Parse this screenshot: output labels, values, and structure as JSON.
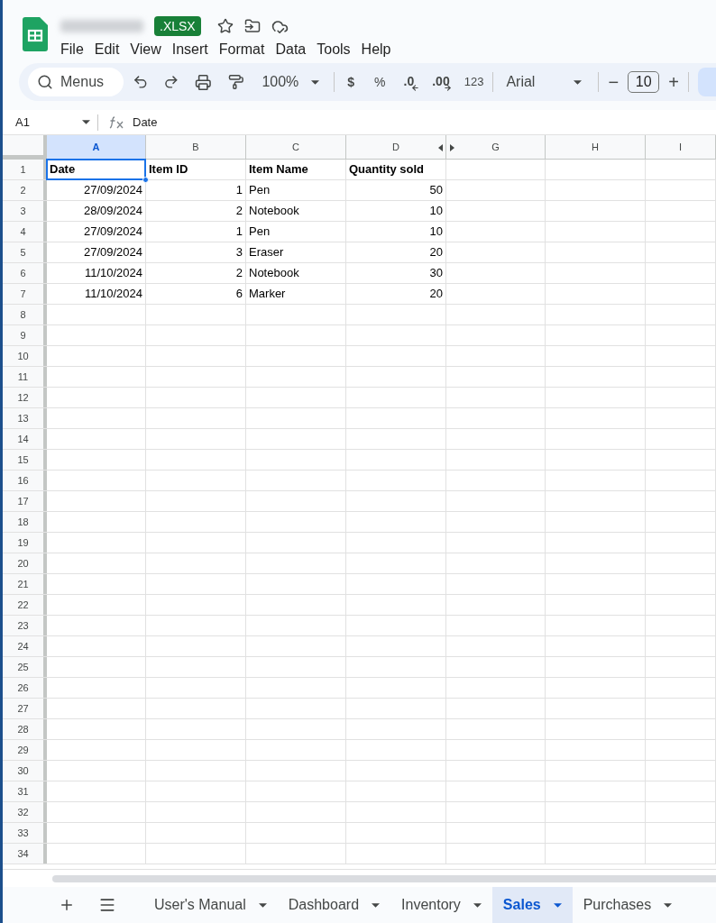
{
  "header": {
    "badge": ".XLSX",
    "menu": [
      "File",
      "Edit",
      "View",
      "Insert",
      "Format",
      "Data",
      "Tools",
      "Help"
    ]
  },
  "toolbar": {
    "search_label": "Menus",
    "zoom": "100%",
    "currency": "$",
    "percent": "%",
    "decrease_decimal": ".0",
    "increase_decimal": ".00",
    "number_format": "123",
    "font": "Arial",
    "font_minus": "−",
    "font_size": "10",
    "font_plus": "+"
  },
  "formula_bar": {
    "name_box": "A1",
    "formula": "Date"
  },
  "grid": {
    "columns": [
      {
        "label": "A",
        "selected": true
      },
      {
        "label": "B",
        "selected": false
      },
      {
        "label": "C",
        "selected": false
      },
      {
        "label": "D",
        "selected": false
      },
      {
        "label": "G",
        "selected": false
      },
      {
        "label": "H",
        "selected": false
      },
      {
        "label": "I",
        "selected": false
      }
    ],
    "row_numbers": [
      "1",
      "2",
      "3",
      "4",
      "5",
      "6",
      "7",
      "8",
      "9",
      "10",
      "11",
      "12",
      "13",
      "14",
      "15",
      "16",
      "17",
      "18",
      "19",
      "20",
      "21",
      "22",
      "23",
      "24",
      "25",
      "26",
      "27",
      "28",
      "29",
      "30",
      "31",
      "32",
      "33",
      "34"
    ],
    "header_row": [
      {
        "text": "Date",
        "selected": true
      },
      {
        "text": "Item ID",
        "selected": false
      },
      {
        "text": "Item Name",
        "selected": false
      },
      {
        "text": "Quantity sold",
        "selected": false
      }
    ],
    "rows": [
      {
        "date": "27/09/2024",
        "item_id": "1",
        "item_name": "Pen",
        "quantity": "50"
      },
      {
        "date": "28/09/2024",
        "item_id": "2",
        "item_name": "Notebook",
        "quantity": "10"
      },
      {
        "date": "27/09/2024",
        "item_id": "1",
        "item_name": "Pen",
        "quantity": "10"
      },
      {
        "date": "27/09/2024",
        "item_id": "3",
        "item_name": "Eraser",
        "quantity": "20"
      },
      {
        "date": "11/10/2024",
        "item_id": "2",
        "item_name": "Notebook",
        "quantity": "30"
      },
      {
        "date": "11/10/2024",
        "item_id": "6",
        "item_name": "Marker",
        "quantity": "20"
      }
    ]
  },
  "sheet_tabs": [
    {
      "label": "User's Manual",
      "selected": false
    },
    {
      "label": "Dashboard",
      "selected": false
    },
    {
      "label": "Inventory",
      "selected": false
    },
    {
      "label": "Sales",
      "selected": true
    },
    {
      "label": "Purchases",
      "selected": false
    }
  ]
}
